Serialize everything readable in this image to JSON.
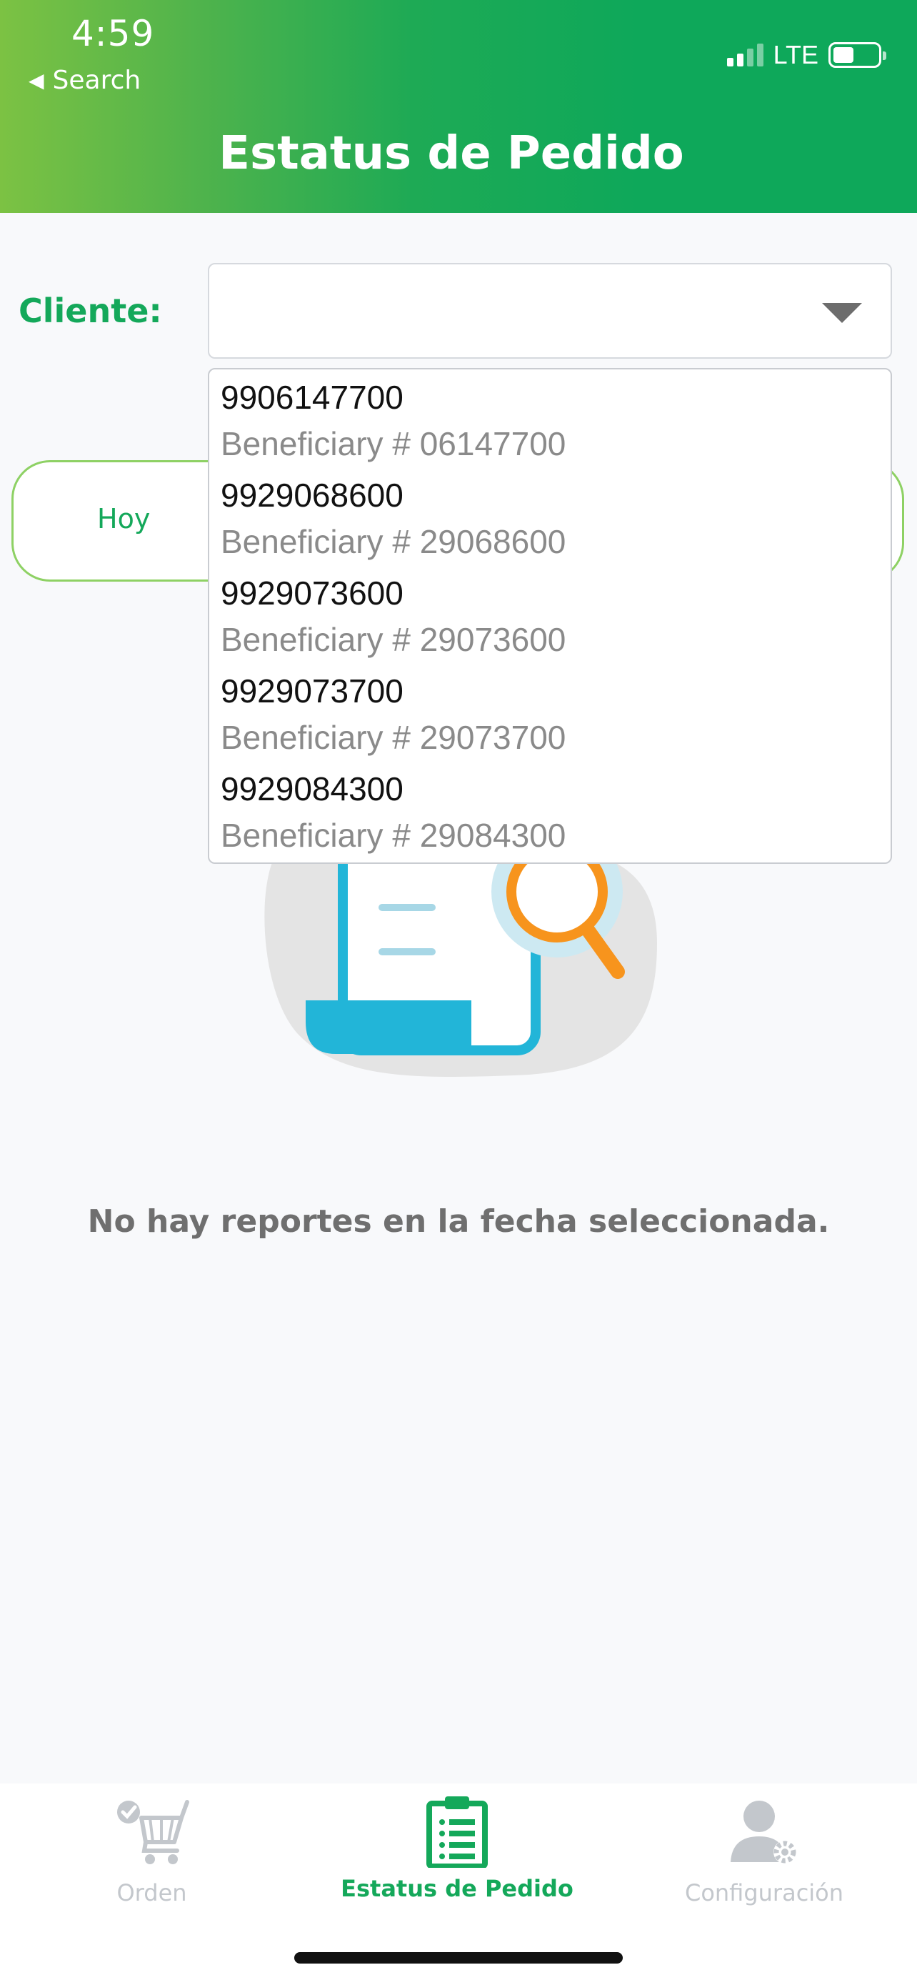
{
  "status_bar": {
    "time": "4:59",
    "back_label": "Search",
    "network": "LTE"
  },
  "header": {
    "title": "Estatus de Pedido"
  },
  "client": {
    "label": "Cliente:",
    "selected_value": "",
    "options": [
      {
        "number": "9906147700",
        "detail": "Beneficiary # 06147700"
      },
      {
        "number": "9929068600",
        "detail": "Beneficiary # 29068600"
      },
      {
        "number": "9929073600",
        "detail": "Beneficiary # 29073600"
      },
      {
        "number": "9929073700",
        "detail": "Beneficiary # 29073700"
      },
      {
        "number": "9929084300",
        "detail": "Beneficiary # 29084300"
      }
    ]
  },
  "date_filter": {
    "today_label": "Hoy"
  },
  "empty_state": {
    "message": "No hay reportes en la fecha seleccionada."
  },
  "tabs": [
    {
      "label": "Orden",
      "icon": "cart-icon",
      "active": false
    },
    {
      "label": "Estatus de Pedido",
      "icon": "clipboard-list-icon",
      "active": true
    },
    {
      "label": "Configuración",
      "icon": "user-settings-icon",
      "active": false
    }
  ],
  "colors": {
    "brand_green": "#14a85a",
    "header_gradient_start": "#7cc243",
    "header_gradient_end": "#0ea85a",
    "illustration_blue": "#22b5d8",
    "illustration_orange": "#f7941d",
    "inactive_tab": "#c3c7cc"
  }
}
